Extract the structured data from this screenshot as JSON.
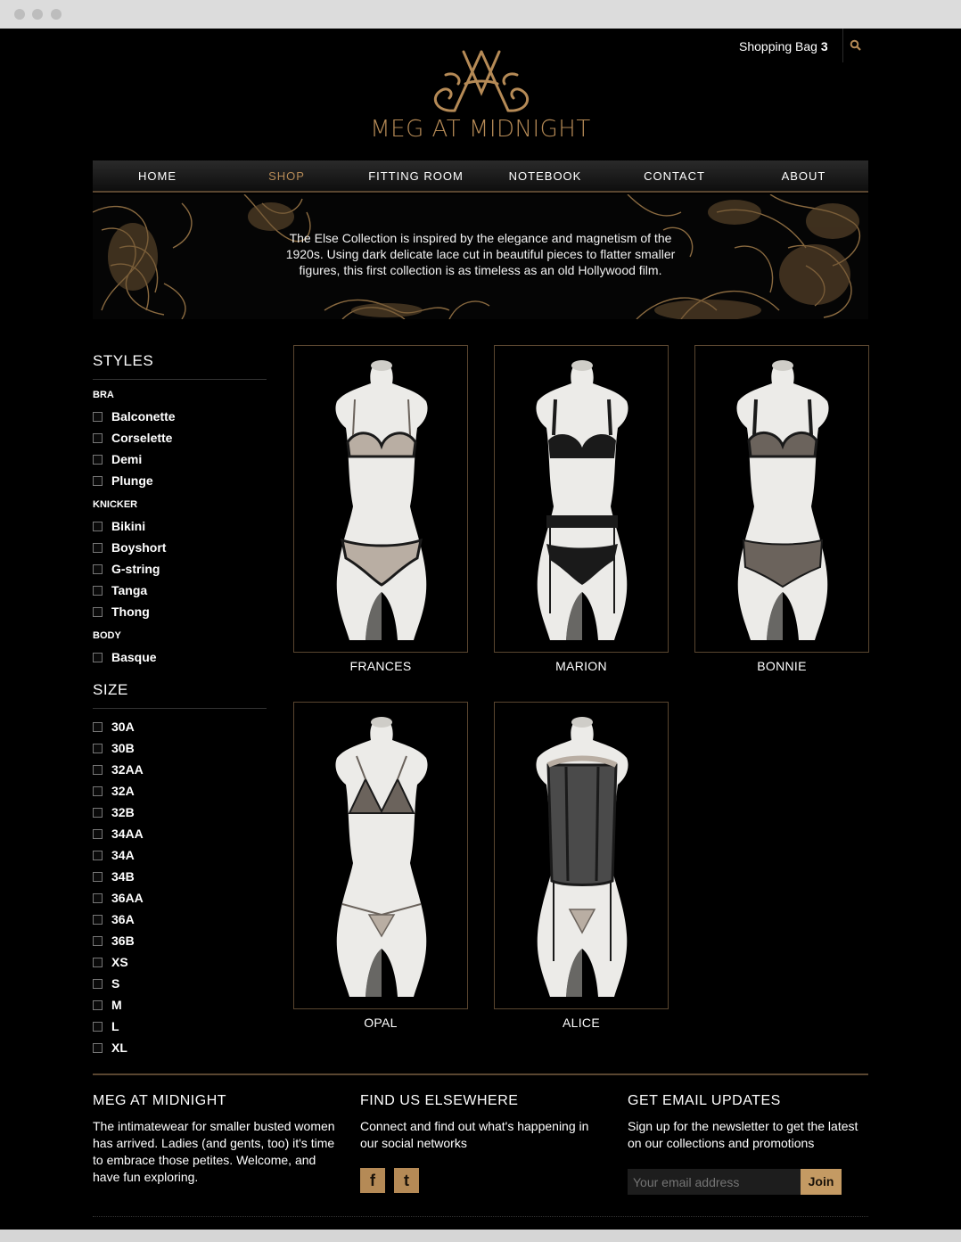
{
  "header": {
    "bag_label": "Shopping Bag",
    "bag_count": "3",
    "brand": "MEG AT MIDNIGHT"
  },
  "nav": {
    "items": [
      {
        "label": "HOME"
      },
      {
        "label": "SHOP",
        "active": true
      },
      {
        "label": "FITTING ROOM"
      },
      {
        "label": "NOTEBOOK"
      },
      {
        "label": "CONTACT"
      },
      {
        "label": "ABOUT"
      }
    ]
  },
  "banner": {
    "text": "The Else Collection is inspired by the elegance and magnetism of the 1920s. Using dark delicate lace cut in beautiful pieces to flatter smaller figures, this first collection is as timeless as an old Hollywood film."
  },
  "sidebar": {
    "styles_heading": "STYLES",
    "bra_label": "BRA",
    "bra": [
      "Balconette",
      "Corselette",
      "Demi",
      "Plunge"
    ],
    "knicker_label": "KNICKER",
    "knicker": [
      "Bikini",
      "Boyshort",
      "G-string",
      "Tanga",
      "Thong"
    ],
    "body_label": "BODY",
    "body": [
      "Basque"
    ],
    "size_heading": "SIZE",
    "sizes": [
      "30A",
      "30B",
      "32AA",
      "32A",
      "32B",
      "34AA",
      "34A",
      "34B",
      "36AA",
      "36A",
      "36B",
      "XS",
      "S",
      "M",
      "L",
      "XL"
    ]
  },
  "products": [
    {
      "name": "FRANCES",
      "style": "set-nude"
    },
    {
      "name": "MARION",
      "style": "set-black-suspender"
    },
    {
      "name": "BONNIE",
      "style": "set-lace"
    },
    {
      "name": "OPAL",
      "style": "triangle-gstring"
    },
    {
      "name": "ALICE",
      "style": "basque"
    }
  ],
  "footer": {
    "about_heading": "MEG AT MIDNIGHT",
    "about_text": "The intimatewear for smaller busted women has arrived. Ladies (and gents, too) it's time to embrace those petites. Welcome, and have fun exploring.",
    "social_heading": "FIND US ELSEWHERE",
    "social_text": "Connect and find out what's happening in our social networks",
    "facebook_glyph": "f",
    "twitter_glyph": "t",
    "email_heading": "GET EMAIL UPDATES",
    "email_text": "Sign up for the newsletter to get the latest on our collections and promotions",
    "email_placeholder": "Your email address",
    "join_label": "Join"
  },
  "colors": {
    "accent": "#b58a56",
    "background": "#000000"
  }
}
